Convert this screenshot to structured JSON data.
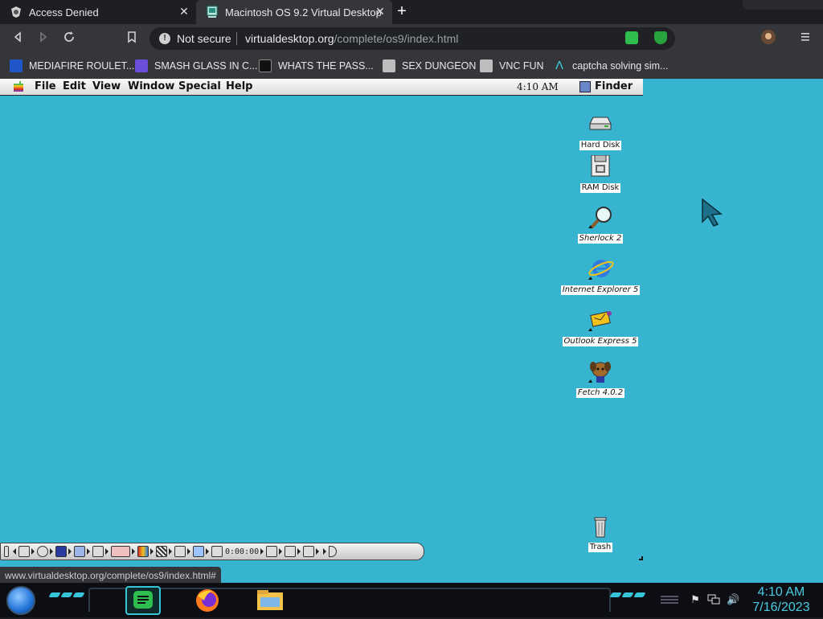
{
  "browser": {
    "tabs": [
      {
        "title": "Access Denied",
        "icon": "sheriff-icon",
        "active": false
      },
      {
        "title": "Macintosh OS 9.2 Virtual Desktop",
        "icon": "computer-icon",
        "active": true
      }
    ],
    "new_tab_label": "+",
    "omnibox": {
      "security_label": "Not secure",
      "url_host": "virtualdesktop.org",
      "url_path": "/complete/os9/index.html"
    },
    "bookmarks": [
      {
        "label": "MEDIAFIRE ROULET...",
        "icon": "mediafire-icon"
      },
      {
        "label": "SMASH GLASS IN C...",
        "icon": "visualstudio-icon"
      },
      {
        "label": "WHATS THE PASS...",
        "icon": "terminal-icon"
      },
      {
        "label": "SEX DUNGEON",
        "icon": "sheriff-icon"
      },
      {
        "label": "VNC FUN",
        "icon": "sheriff-icon"
      },
      {
        "label": "captcha solving sim...",
        "icon": "lambda-icon"
      }
    ],
    "status_link": "www.virtualdesktop.org/complete/os9/index.html#"
  },
  "macos": {
    "menubar": {
      "items": [
        "File",
        "Edit",
        "View",
        "Window",
        "Special",
        "Help"
      ],
      "clock": "4:10 AM",
      "app_name": "Finder"
    },
    "desktop_icons": [
      {
        "label": "Hard Disk",
        "icon": "hard-disk-icon",
        "alias": false
      },
      {
        "label": "RAM Disk",
        "icon": "ram-disk-icon",
        "alias": false
      },
      {
        "label": "Sherlock 2",
        "icon": "sherlock-icon",
        "alias": true
      },
      {
        "label": "Internet Explorer 5",
        "icon": "internet-explorer-icon",
        "alias": true
      },
      {
        "label": "Outlook Express 5",
        "icon": "outlook-express-icon",
        "alias": true
      },
      {
        "label": "Fetch 4.0.2",
        "icon": "fetch-dog-icon",
        "alias": true
      },
      {
        "label": "Trash",
        "icon": "trash-icon",
        "alias": false
      }
    ],
    "control_strip": {
      "timer": "0:00:00"
    },
    "desktop_color": "#36b4d0"
  },
  "taskbar": {
    "clock_time": "4:10 AM",
    "clock_date": "7/16/2023",
    "accent_color": "#49cbe0"
  }
}
